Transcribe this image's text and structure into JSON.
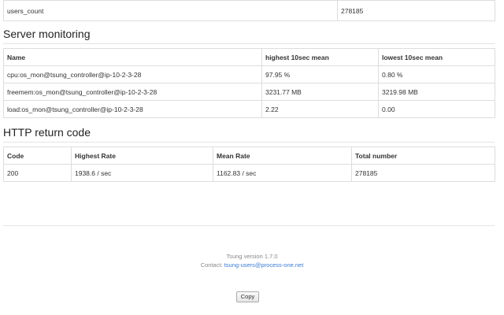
{
  "top_table": {
    "row": {
      "label": "users_count",
      "value": "278185"
    }
  },
  "server_monitoring": {
    "title": "Server monitoring",
    "headers": [
      "Name",
      "highest 10sec mean",
      "lowest 10sec mean"
    ],
    "rows": [
      [
        "cpu:os_mon@tsung_controller@ip-10-2-3-28",
        "97.95 %",
        "0.80 %"
      ],
      [
        "freemem:os_mon@tsung_controller@ip-10-2-3-28",
        "3231.77 MB",
        "3219.98 MB"
      ],
      [
        "load:os_mon@tsung_controller@ip-10-2-3-28",
        "2.22",
        "0.00"
      ]
    ]
  },
  "http_return_code": {
    "title": "HTTP return code",
    "headers": [
      "Code",
      "Highest Rate",
      "Mean Rate",
      "Total number"
    ],
    "rows": [
      [
        "200",
        "1938.6 / sec",
        "1162.83 / sec",
        "278185"
      ]
    ]
  },
  "footer": {
    "version": "Tsung version 1.7.0",
    "contact_label": "Contact:",
    "contact_email": "tsung-users@process-one.net"
  },
  "copy_button": {
    "label": "Copy"
  },
  "colors": {
    "link": "#3a7bd5",
    "border": "#dddddd",
    "text": "#333333"
  }
}
